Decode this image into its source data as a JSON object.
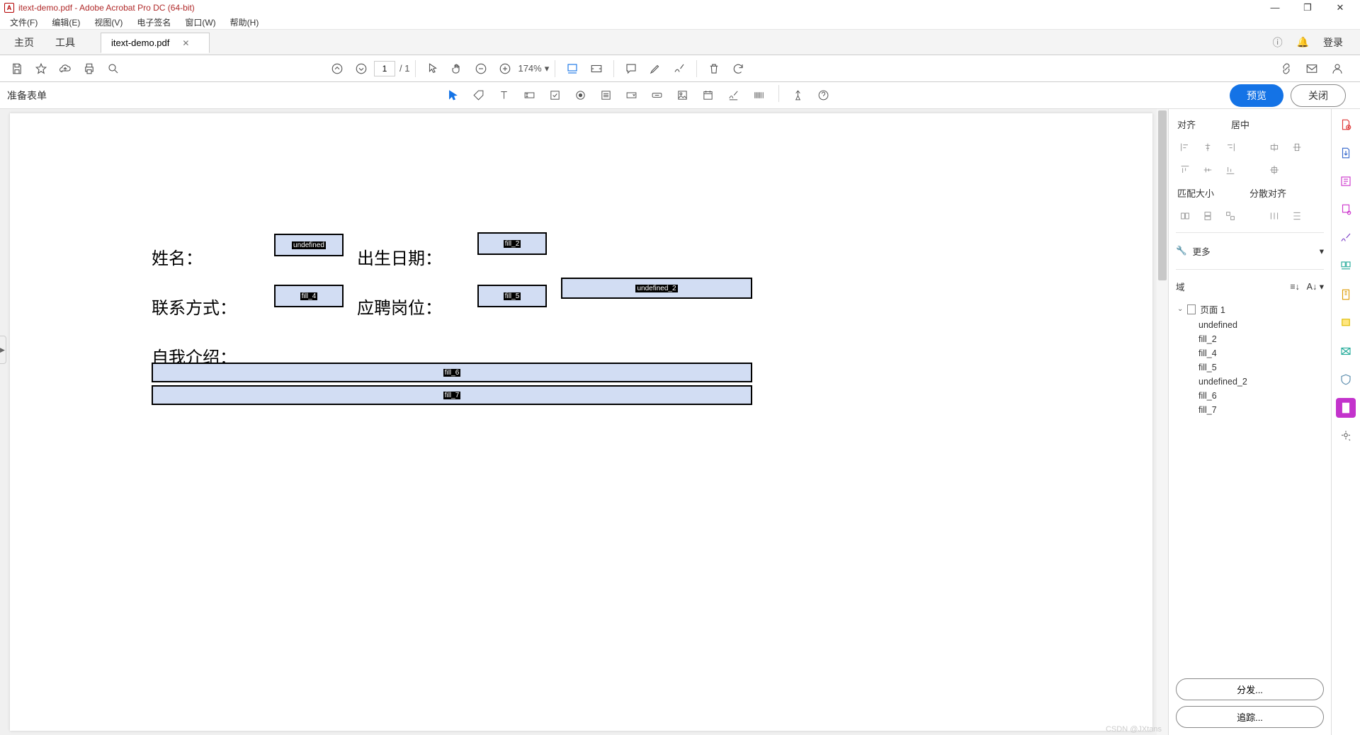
{
  "window": {
    "title": "itext-demo.pdf - Adobe Acrobat Pro DC (64-bit)",
    "app_badge": "A"
  },
  "menu": {
    "file": "文件(F)",
    "edit": "编辑(E)",
    "view": "视图(V)",
    "sign": "电子签名",
    "window": "窗口(W)",
    "help": "帮助(H)"
  },
  "tabs": {
    "home": "主页",
    "tools": "工具",
    "doc": "itext-demo.pdf",
    "login": "登录"
  },
  "toolbar": {
    "page_current": "1",
    "page_total": "/ 1",
    "zoom": "174%"
  },
  "formbar": {
    "title": "准备表单",
    "preview": "预览",
    "close": "关闭"
  },
  "form": {
    "labels": {
      "name": "姓名：",
      "dob": "出生日期：",
      "contact": "联系方式：",
      "position": "应聘岗位：",
      "intro": "自我介绍："
    },
    "fields": {
      "undefined": "undefined",
      "fill_2": "fill_2",
      "fill_4": "fill_4",
      "fill_5": "fill_5",
      "undefined_2": "undefined_2",
      "fill_6": "fill_6",
      "fill_7": "fill_7"
    }
  },
  "panel": {
    "align": "对齐",
    "center": "居中",
    "match_size": "匹配大小",
    "distribute": "分散对齐",
    "more": "更多",
    "fields": "域",
    "page1": "页面 1",
    "field_list": [
      "undefined",
      "fill_2",
      "fill_4",
      "fill_5",
      "undefined_2",
      "fill_6",
      "fill_7"
    ],
    "distribute_btn": "分发...",
    "track_btn": "追踪..."
  },
  "watermark": "CSDN @JXtans"
}
